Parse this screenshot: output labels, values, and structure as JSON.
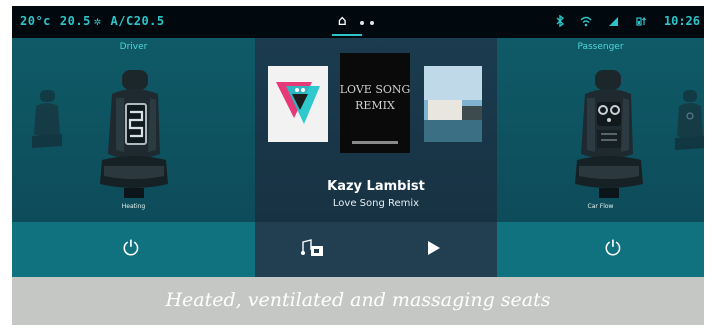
{
  "status_bar": {
    "temp_left": "20°c",
    "fan_level": "20.5",
    "fan_icon": "fan-icon",
    "ac": "A/C20.5",
    "time": "10:26",
    "icons": [
      "bluetooth-icon",
      "wifi-icon",
      "signal-icon",
      "battery-icon"
    ]
  },
  "home_indicator": {
    "icon": "home-icon",
    "page_count": 3,
    "active_page": 1
  },
  "driver_panel": {
    "title": "Driver",
    "caption": "Heating",
    "power_icon": "power-icon"
  },
  "media_panel": {
    "artist": "Kazy Lambist",
    "track": "Love Song Remix",
    "album_art_text": "LOVE SONG REMIX",
    "controls": [
      "media-source-icon",
      "play-icon"
    ]
  },
  "passenger_panel": {
    "title": "Passenger",
    "caption": "Car Flow",
    "power_icon": "power-icon"
  },
  "caption": {
    "text": "Heated, ventilated and massaging seats"
  },
  "colors": {
    "accent": "#2fc3c8",
    "panel_teal": "#0f5a67",
    "media_bg": "#1b3b4f",
    "caption_bg": "#c5c7c5"
  }
}
